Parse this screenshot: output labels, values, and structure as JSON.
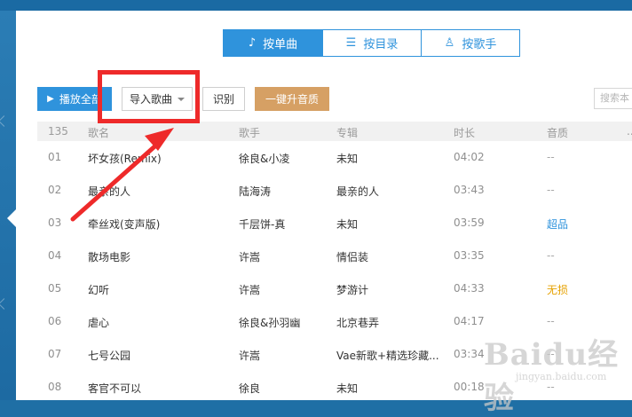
{
  "tabs": [
    {
      "label": "按单曲",
      "icon": "music-note-icon",
      "active": true
    },
    {
      "label": "按目录",
      "icon": "list-icon",
      "active": false
    },
    {
      "label": "按歌手",
      "icon": "user-icon",
      "active": false
    }
  ],
  "toolbar": {
    "play_all_label": "播放全部",
    "import_label": "导入歌曲",
    "recognize_label": "识别",
    "upgrade_label": "一键升音质",
    "search_placeholder": "搜索本"
  },
  "table": {
    "headers": [
      "135",
      "歌名",
      "歌手",
      "专辑",
      "时长",
      "音质",
      "..."
    ],
    "rows": [
      {
        "num": "01",
        "title": "坏女孩(Remix)",
        "artist": "徐良&小凌",
        "album": "未知",
        "duration": "04:02",
        "quality": "--",
        "quality_type": "none"
      },
      {
        "num": "02",
        "title": "最亲的人",
        "artist": "陆海涛",
        "album": "最亲的人",
        "duration": "03:43",
        "quality": "--",
        "quality_type": "none"
      },
      {
        "num": "03",
        "title": "牵丝戏(变声版)",
        "artist": "千层饼-真",
        "album": "未知",
        "duration": "03:59",
        "quality": "超品",
        "quality_type": "hq"
      },
      {
        "num": "04",
        "title": "散场电影",
        "artist": "许嵩",
        "album": "情侣装",
        "duration": "03:35",
        "quality": "--",
        "quality_type": "none"
      },
      {
        "num": "05",
        "title": "幻听",
        "artist": "许嵩",
        "album": "梦游计",
        "duration": "04:33",
        "quality": "无损",
        "quality_type": "lossless"
      },
      {
        "num": "06",
        "title": "虐心",
        "artist": "徐良&孙羽幽",
        "album": "北京巷弄",
        "duration": "04:17",
        "quality": "--",
        "quality_type": "none"
      },
      {
        "num": "07",
        "title": "七号公园",
        "artist": "许嵩",
        "album": "Vae新歌+精选珍藏...",
        "duration": "03:34",
        "quality": "--",
        "quality_type": "none"
      },
      {
        "num": "08",
        "title": "客官不可以",
        "artist": "徐良",
        "album": "未知",
        "duration": "00:18",
        "quality": "--",
        "quality_type": "none"
      }
    ]
  },
  "watermark": {
    "main": "Baidu经验",
    "sub": "jingyan.baidu.com"
  },
  "colors": {
    "accent": "#2f93dc",
    "upgrade": "#d6a064",
    "annotation": "#ee2a2a",
    "hq": "#2f93dc",
    "lossless": "#e6a100"
  }
}
